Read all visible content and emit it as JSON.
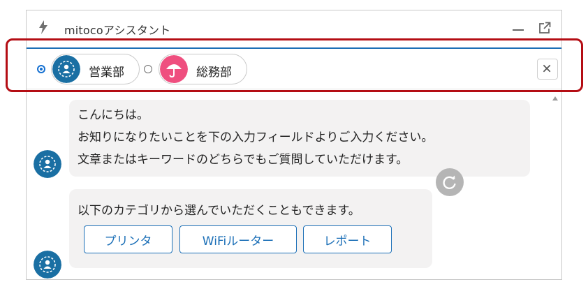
{
  "window": {
    "title": "mitocoアシスタント",
    "icons": [
      "bolt-icon",
      "minimize-icon",
      "popout-icon",
      "close-icon"
    ]
  },
  "selector": {
    "options": [
      {
        "label": "営業部",
        "selected": true,
        "icon": "team-avatar-icon",
        "color": "#1a6fa3"
      },
      {
        "label": "総務部",
        "selected": false,
        "icon": "umbrella-avatar-icon",
        "color": "#ef4f7f"
      }
    ]
  },
  "chat": {
    "messages": [
      {
        "lines": [
          "こんにちは。",
          "お知りになりたいことを下の入力フィールドよりご入力ください。",
          "文章またはキーワードのどちらでもご質問していただけます。"
        ]
      },
      {
        "lines": [
          "以下のカテゴリから選んでいただくこともできます。"
        ],
        "buttons": [
          "プリンタ",
          "WiFiルーター",
          "レポート"
        ]
      }
    ]
  },
  "colors": {
    "accent": "#1b6fb7",
    "highlight": "#b40d14",
    "bubble": "#f3f2f2",
    "bot_avatar": "#1a6fa3"
  }
}
